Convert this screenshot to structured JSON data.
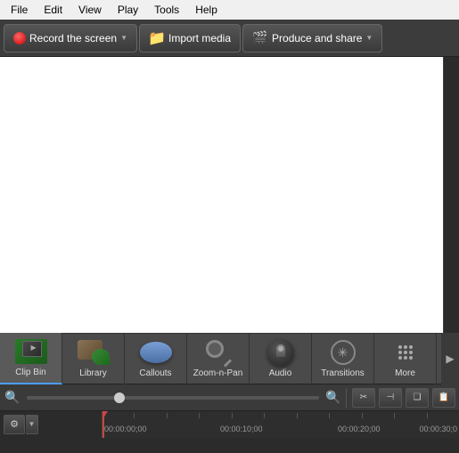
{
  "menu": {
    "items": [
      "File",
      "Edit",
      "View",
      "Play",
      "Tools",
      "Help"
    ]
  },
  "toolbar": {
    "record_label": "Record the screen",
    "import_label": "Import media",
    "produce_label": "Produce and share"
  },
  "bottom_toolbar": {
    "items": [
      {
        "id": "clip-bin",
        "label": "Clip Bin",
        "active": true
      },
      {
        "id": "library",
        "label": "Library"
      },
      {
        "id": "callouts",
        "label": "Callouts"
      },
      {
        "id": "zoom-n-pan",
        "label": "Zoom-n-Pan"
      },
      {
        "id": "audio",
        "label": "Audio"
      },
      {
        "id": "transitions",
        "label": "Transitions"
      },
      {
        "id": "more",
        "label": "More"
      }
    ]
  },
  "timeline": {
    "markers": [
      {
        "time": "00:00:00;00",
        "pos": "0%"
      },
      {
        "time": "00:00:10;00",
        "pos": "33%"
      },
      {
        "time": "00:00:20;00",
        "pos": "66%"
      },
      {
        "time": "00:00:30;0",
        "pos": "99%"
      }
    ]
  }
}
